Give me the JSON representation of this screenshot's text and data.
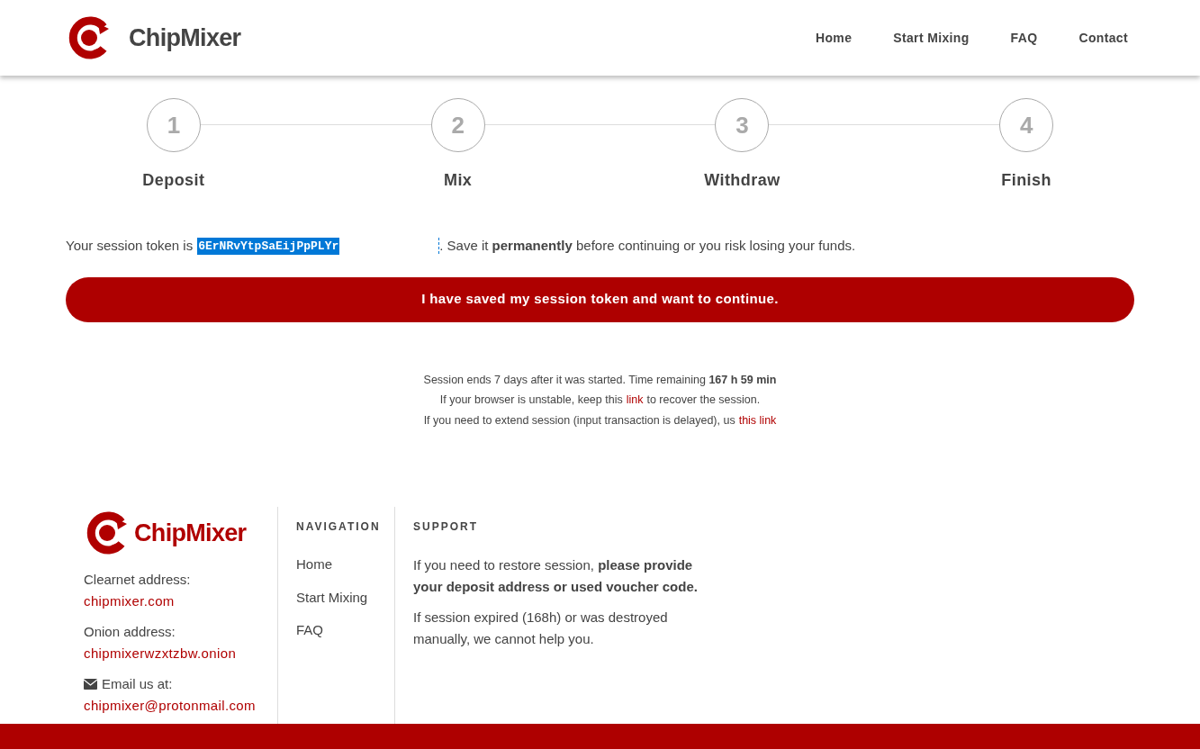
{
  "header": {
    "logo": "ChipMixer",
    "nav": [
      "Home",
      "Start Mixing",
      "FAQ",
      "Contact"
    ]
  },
  "steps": [
    {
      "number": "1",
      "label": "Deposit"
    },
    {
      "number": "2",
      "label": "Mix"
    },
    {
      "number": "3",
      "label": "Withdraw"
    },
    {
      "number": "4",
      "label": "Finish"
    }
  ],
  "token": {
    "prefix": "Your session token is",
    "value": "6ErNRvYtpSaEijPpPLYr",
    "suffix": ". Save it **permanently** before continuing or you risk losing your funds."
  },
  "continue_button": "I have saved my session token and want to continue.",
  "session_info": [
    {
      "before": "Session ends 7 days after it was started. Time remaining **167 h 59 min**"
    },
    {
      "before": "If your browser is unstable, keep this",
      "link": "link",
      "after": "to recover the session."
    },
    {
      "before": "If you need to extend session (input transaction is delayed), us",
      "link": "this link"
    }
  ],
  "footer": {
    "logo": "ChipMixer",
    "contacts": [
      {
        "kind": "address",
        "label": "Clearnet address:",
        "link": "chipmixer.com"
      },
      {
        "kind": "address",
        "label": "Onion address:",
        "link": "chipmixerwzxtzbw.onion"
      },
      {
        "kind": "email",
        "label": "Email us at:",
        "link": "chipmixer@protonmail.com"
      }
    ],
    "navigation": {
      "heading": "NAVIGATION",
      "items": [
        "Home",
        "Start Mixing",
        "FAQ"
      ]
    },
    "support": {
      "heading": "SUPPORT",
      "paragraphs": [
        "If you need to restore session, **please provide your deposit address or used voucher code.**",
        "If session expired (168h) or was destroyed manually, we cannot help you."
      ]
    }
  }
}
